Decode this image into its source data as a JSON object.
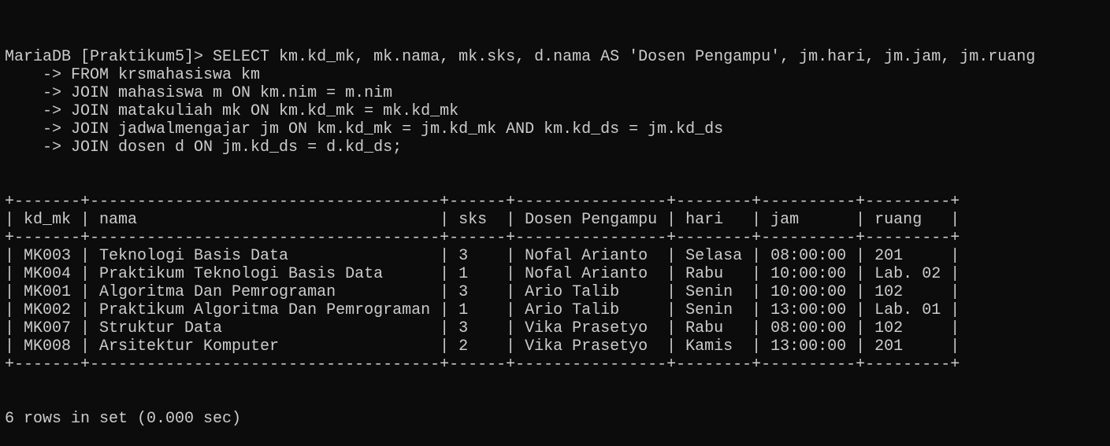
{
  "terminal": {
    "prompt": "MariaDB [Praktikum5]> ",
    "continuation": "    -> ",
    "query_lines": [
      "SELECT km.kd_mk, mk.nama, mk.sks, d.nama AS 'Dosen Pengampu', jm.hari, jm.jam, jm.ruang",
      "FROM krsmahasiswa km",
      "JOIN mahasiswa m ON km.nim = m.nim",
      "JOIN matakuliah mk ON km.kd_mk = mk.kd_mk",
      "JOIN jadwalmengajar jm ON km.kd_mk = jm.kd_mk AND km.kd_ds = jm.kd_ds",
      "JOIN dosen d ON jm.kd_ds = d.kd_ds;"
    ],
    "colors": {
      "background": "#0c0c0c",
      "text": "#cccccc"
    }
  },
  "result": {
    "columns": [
      "kd_mk",
      "nama",
      "sks",
      "Dosen Pengampu",
      "hari",
      "jam",
      "ruang"
    ],
    "rows": [
      [
        "MK003",
        "Teknologi Basis Data",
        "3",
        "Nofal Arianto",
        "Selasa",
        "08:00:00",
        "201"
      ],
      [
        "MK004",
        "Praktikum Teknologi Basis Data",
        "1",
        "Nofal Arianto",
        "Rabu",
        "10:00:00",
        "Lab. 02"
      ],
      [
        "MK001",
        "Algoritma Dan Pemrograman",
        "3",
        "Ario Talib",
        "Senin",
        "10:00:00",
        "102"
      ],
      [
        "MK002",
        "Praktikum Algoritma Dan Pemrograman",
        "1",
        "Ario Talib",
        "Senin",
        "13:00:00",
        "Lab. 01"
      ],
      [
        "MK007",
        "Struktur Data",
        "3",
        "Vika Prasetyo",
        "Rabu",
        "08:00:00",
        "102"
      ],
      [
        "MK008",
        "Arsitektur Komputer",
        "2",
        "Vika Prasetyo",
        "Kamis",
        "13:00:00",
        "201"
      ]
    ],
    "summary": "6 rows in set (0.000 sec)"
  }
}
